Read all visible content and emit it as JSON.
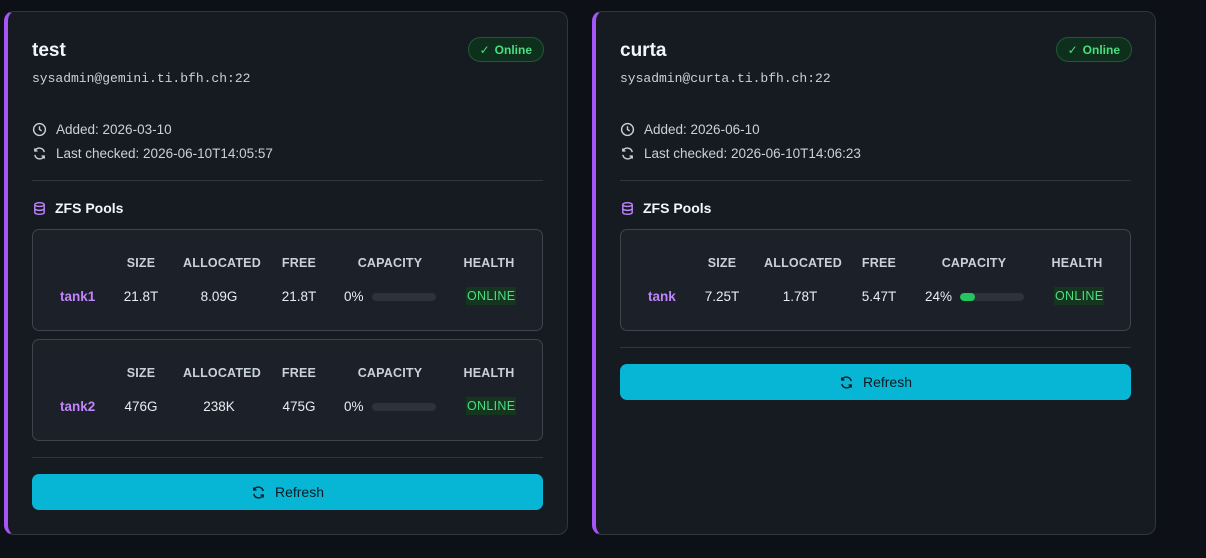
{
  "hosts": [
    {
      "name": "test",
      "ssh": "sysadmin@gemini.ti.bfh.ch:22",
      "status": "Online",
      "added": "Added: 2026-03-10",
      "last_checked": "Last checked: 2026-06-10T14:05:57",
      "pools_title": "ZFS Pools",
      "pools": [
        {
          "name": "tank1",
          "size": "21.8T",
          "allocated": "8.09G",
          "free": "21.8T",
          "capacity": "0%",
          "capacity_fraction": 0.0,
          "health": "ONLINE"
        },
        {
          "name": "tank2",
          "size": "476G",
          "allocated": "238K",
          "free": "475G",
          "capacity": "0%",
          "capacity_fraction": 0.0,
          "health": "ONLINE"
        }
      ],
      "refresh_label": "Refresh"
    },
    {
      "name": "curta",
      "ssh": "sysadmin@curta.ti.bfh.ch:22",
      "status": "Online",
      "added": "Added: 2026-06-10",
      "last_checked": "Last checked: 2026-06-10T14:06:23",
      "pools_title": "ZFS Pools",
      "pools": [
        {
          "name": "tank",
          "size": "7.25T",
          "allocated": "1.78T",
          "free": "5.47T",
          "capacity": "24%",
          "capacity_fraction": 0.24,
          "health": "ONLINE"
        }
      ],
      "refresh_label": "Refresh"
    }
  ],
  "pool_columns": {
    "size": "SIZE",
    "allocated": "ALLOCATED",
    "free": "FREE",
    "capacity": "CAPACITY",
    "health": "HEALTH"
  },
  "icons": {
    "status": "check-icon",
    "added": "clock-icon",
    "checked": "refresh-icon",
    "pools": "database-icon",
    "refresh": "refresh-icon"
  },
  "colors": {
    "accent": "#a855f7",
    "online": "#4ade80",
    "button": "#06b6d4",
    "pool_name": "#c084fc"
  }
}
